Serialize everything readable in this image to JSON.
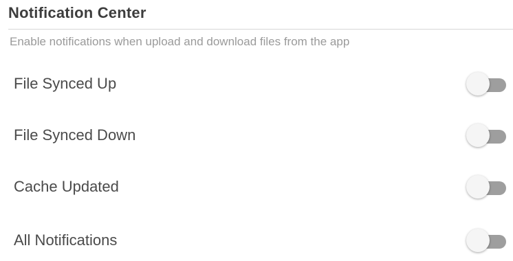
{
  "header": {
    "title": "Notification Center",
    "subtitle": "Enable notifications when upload and download files from the app"
  },
  "settings": [
    {
      "label": "File Synced Up",
      "enabled": false
    },
    {
      "label": "File Synced Down",
      "enabled": false
    },
    {
      "label": "Cache Updated",
      "enabled": false
    },
    {
      "label": "All Notifications",
      "enabled": false
    }
  ],
  "colors": {
    "toggle_track_off": "#9e9e9e",
    "toggle_thumb_off": "#f5f5f5",
    "divider": "#d6d6d6",
    "subtitle_text": "#9a9a9a"
  }
}
